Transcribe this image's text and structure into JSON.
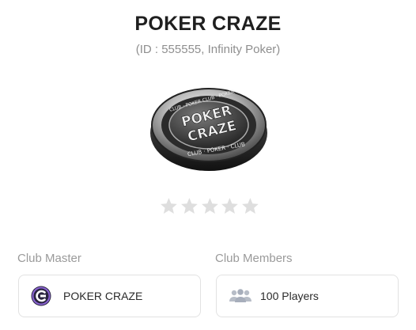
{
  "header": {
    "title": "POKER CRAZE",
    "subtitle": "(ID : 555555, Infinity Poker)"
  },
  "logo": {
    "top_text": "POKER",
    "bottom_text": "CRAZE",
    "ring_text_top": "CLUB · POKER CLUB · POKER",
    "ring_text_bottom": "CLUB · POKER · CLUB"
  },
  "rating": {
    "stars": 5,
    "filled": 0
  },
  "club_master": {
    "label": "Club Master",
    "name": "POKER CRAZE",
    "icon": "club-logo-icon"
  },
  "club_members": {
    "label": "Club Members",
    "value": "100 Players",
    "icon": "group-icon"
  },
  "colors": {
    "title": "#1f1f1f",
    "subtitle": "#8f8f8f",
    "star_empty": "#dedede",
    "card_border": "#e2e2e2",
    "badge_purple": "#6a3bb0"
  }
}
